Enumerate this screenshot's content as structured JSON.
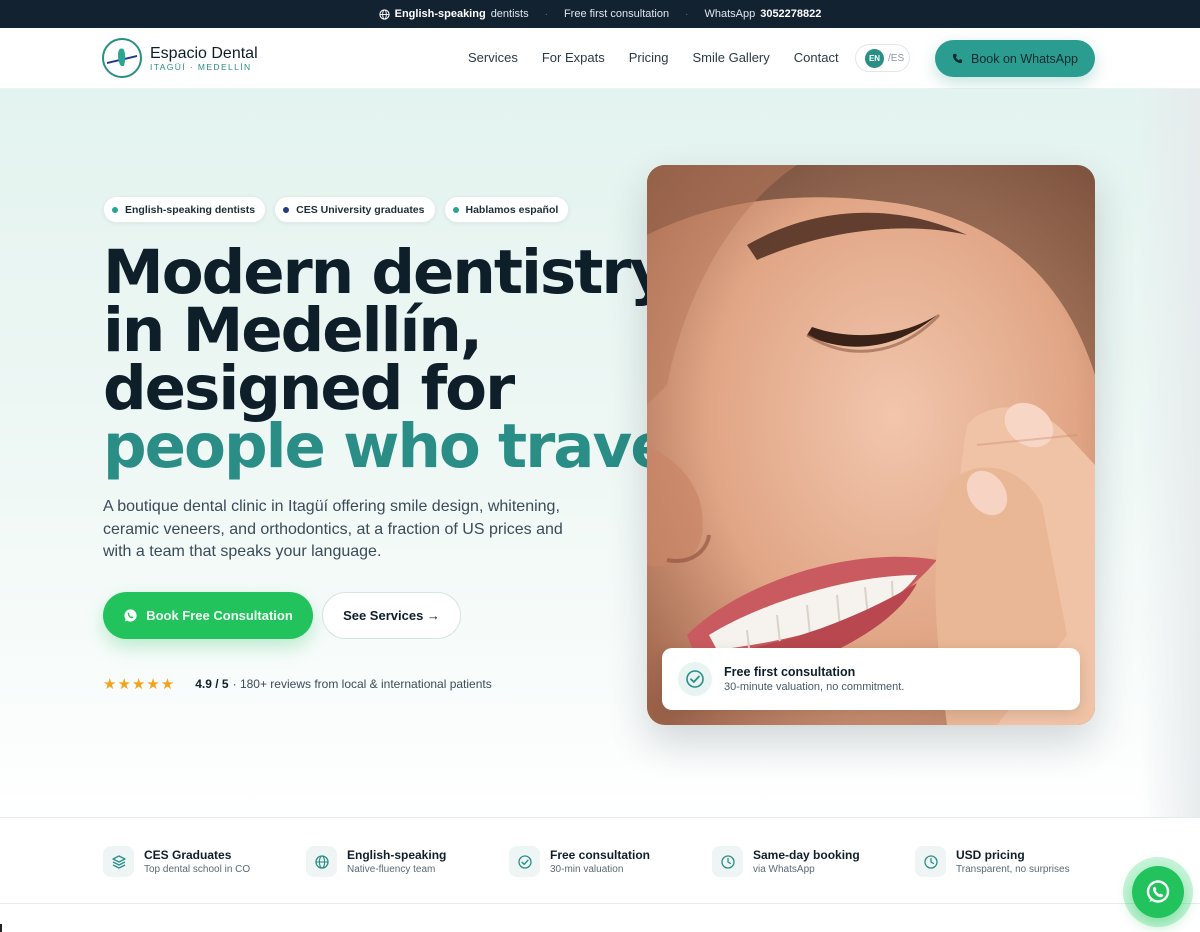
{
  "topbar": {
    "item1_bold": "English-speaking",
    "item1_rest": "dentists",
    "item2": "Free first consultation",
    "item3_label": "WhatsApp",
    "item3_number": "3052278822",
    "separator": "·"
  },
  "nav": {
    "brand_name": "Espacio Dental",
    "brand_sub": "ITAGÜÍ · MEDELLÍN",
    "links": [
      "Services",
      "For Expats",
      "Pricing",
      "Smile Gallery",
      "Contact"
    ],
    "lang_active": "EN",
    "lang_other": "/ES",
    "cta": "Book on WhatsApp"
  },
  "hero": {
    "badges": [
      {
        "label": "English-speaking dentists",
        "dot_color": "#2aa58f"
      },
      {
        "label": "CES University graduates",
        "dot_color": "#1f3b8a"
      },
      {
        "label": "Hablamos español",
        "dot_color": "#2aa58f"
      }
    ],
    "headline_line1": "Modern dentistry",
    "headline_line2": "in Medellín,",
    "headline_line3": "designed for",
    "headline_accent": "people who travel.",
    "lede": "A boutique dental clinic in Itagüí offering smile design, whitening, ceramic veneers, and orthodontics, at a fraction of US prices and with a team that speaks your language.",
    "cta_primary": "Book Free Consultation",
    "cta_secondary": "See Services →",
    "rating_stars": "★★★★★",
    "rating_value": "4.9 / 5",
    "rating_text": "· 180+ reviews from local & international patients",
    "rating": 4.9,
    "consult_title": "Free first consultation",
    "consult_sub": "30-minute valuation, no commitment."
  },
  "features": [
    {
      "title": "CES Graduates",
      "sub": "Top dental school in CO",
      "icon": "layers-icon"
    },
    {
      "title": "English-speaking",
      "sub": "Native-fluency team",
      "icon": "globe-icon"
    },
    {
      "title": "Free consultation",
      "sub": "30-min valuation",
      "icon": "check-circle-icon"
    },
    {
      "title": "Same-day booking",
      "sub": "via WhatsApp",
      "icon": "clock-icon"
    },
    {
      "title": "USD pricing",
      "sub": "Transparent, no surprises",
      "icon": "clock-icon"
    }
  ],
  "colors": {
    "accent": "#2a8e86",
    "whatsapp_green": "#22c35c",
    "topbar_bg": "#122230",
    "star": "#f2a31b"
  }
}
